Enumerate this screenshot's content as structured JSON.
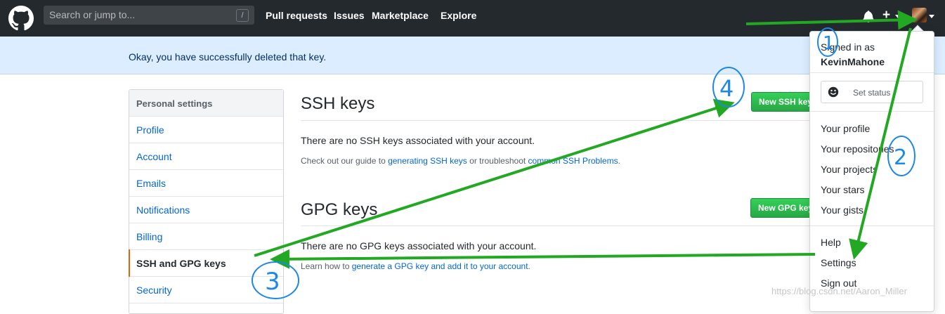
{
  "header": {
    "search_placeholder": "Search or jump to...",
    "search_shortcut": "/",
    "nav": [
      "Pull requests",
      "Issues",
      "Marketplace",
      "Explore"
    ],
    "plus": "+"
  },
  "flash": {
    "message": "Okay, you have successfully deleted that key."
  },
  "sidebar": {
    "heading": "Personal settings",
    "items": [
      {
        "label": "Profile"
      },
      {
        "label": "Account"
      },
      {
        "label": "Emails"
      },
      {
        "label": "Notifications"
      },
      {
        "label": "Billing"
      },
      {
        "label": "SSH and GPG keys"
      },
      {
        "label": "Security"
      }
    ],
    "selected": "SSH and GPG keys"
  },
  "ssh": {
    "title": "SSH keys",
    "button": "New SSH key",
    "empty": "There are no SSH keys associated with your account.",
    "help_prefix": "Check out our guide to ",
    "help_link1": "generating SSH keys",
    "help_mid": " or troubleshoot ",
    "help_link2": "common SSH Problems",
    "help_suffix": "."
  },
  "gpg": {
    "title": "GPG keys",
    "button": "New GPG key",
    "empty": "There are no GPG keys associated with your account.",
    "help_prefix": "Learn how to ",
    "help_link": "generate a GPG key and add it to your account",
    "help_suffix": "."
  },
  "dropdown": {
    "signed_in_as": "Signed in as",
    "username": "KevinMahone",
    "set_status": "Set status",
    "group1": [
      "Your profile",
      "Your repositories",
      "Your projects",
      "Your stars",
      "Your gists"
    ],
    "group2": [
      "Help",
      "Settings",
      "Sign out"
    ]
  },
  "annotations": [
    "1",
    "2",
    "3",
    "4"
  ],
  "watermark": "https://blog.csdn.net/Aaron_Miller",
  "colors": {
    "header_bg": "#24292e",
    "flash_bg": "#dbedff",
    "link": "#0366d6",
    "button_green": "#28a745",
    "arrow_green": "#22a822",
    "annotation_blue": "#1e88e5",
    "selected_marker": "#e36209"
  }
}
